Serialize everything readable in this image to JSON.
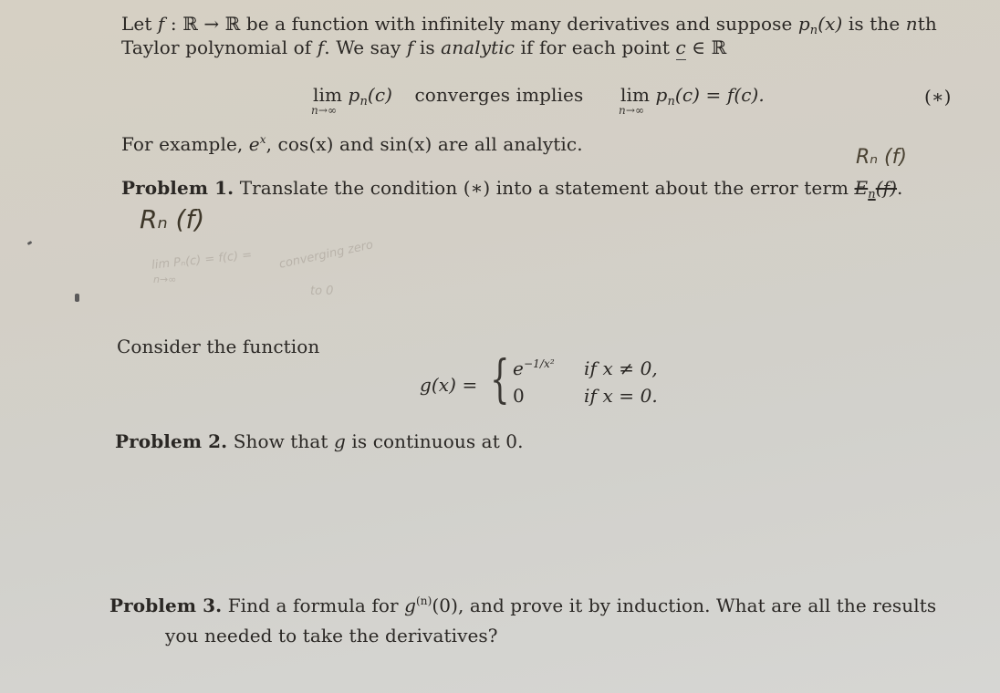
{
  "intro": {
    "line1_prefix": "Let ",
    "line1_f": "f",
    "line1_map": " : ℝ → ℝ ",
    "line1_rest": "be a function with infinitely many derivatives and suppose ",
    "line1_pn": "p",
    "line1_n": "n",
    "line1_x": "(x)",
    "line1_tail": " is the ",
    "line1_nth_n": "n",
    "line1_nth": "th",
    "line2_prefix": "Taylor polynomial of ",
    "line2_f": "f",
    "line2_mid": ". We say ",
    "line2_f2": "f",
    "line2_is": " is ",
    "line2_analytic": "analytic",
    "line2_tail": " if for each point ",
    "line2_c": "c",
    "line2_in": " ∈ ℝ"
  },
  "condition": {
    "lim1": "lim",
    "lim1_under": "n→∞",
    "lhs_p": "p",
    "lhs_n": "n",
    "lhs_arg": "(c)",
    "mid_text": "converges implies",
    "lim2": "lim",
    "lim2_under": "n→∞",
    "rhs_p": "p",
    "rhs_n": "n",
    "rhs_arg": "(c) = ",
    "rhs_f": "f",
    "rhs_end": "(c).",
    "tag": "(∗)"
  },
  "example": {
    "prefix": "For example, ",
    "e": "e",
    "e_sup": "x",
    "rest": ", cos(x) and sin(x) are all analytic."
  },
  "problem1": {
    "label": "Problem 1.",
    "text": " Translate the condition (∗) into a statement about the error term ",
    "error_term_struck": "E",
    "error_term_n": "n",
    "error_term_arg": "(f)",
    "end": "."
  },
  "consider": {
    "text": "Consider the function"
  },
  "piecewise": {
    "lhs": "g(x) = ",
    "case1_value": "e",
    "case1_exp": "−1/x²",
    "case1_cond": "if x ≠ 0,",
    "case2_value": "0",
    "case2_cond": "if x = 0."
  },
  "problem2": {
    "label": "Problem 2.",
    "text": " Show that ",
    "g": "g",
    "tail": " is continuous at 0."
  },
  "problem3": {
    "label": "Problem 3.",
    "text_a": " Find a formula for ",
    "g": "g",
    "sup": "(n)",
    "text_b": "(0), and prove it by induction. What are all the results",
    "line2": "you needed to take the derivatives?"
  },
  "handwriting": {
    "rn_top": "Rₙ (f)",
    "rn_left": "Rₙ (f)",
    "pencil_1": "lim Pₙ(c) = f(c) =",
    "pencil_2": "n→∞",
    "pencil_3": "converging zero",
    "pencil_4": "to 0"
  }
}
